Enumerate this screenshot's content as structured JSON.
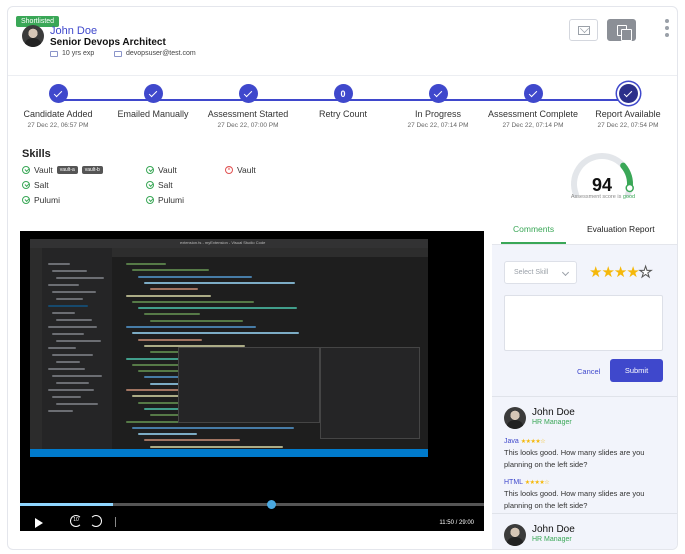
{
  "candidate": {
    "badge": "Shortlisted",
    "name": "John Doe",
    "title": "Senior Devops Architect",
    "experience": "10 yrs exp",
    "email": "devopsuser@test.com"
  },
  "timeline": {
    "steps": [
      {
        "label": "Candidate Added",
        "time": "27 Dec 22,  06:57 PM",
        "state": "done"
      },
      {
        "label": "Emailed Manually",
        "time": "",
        "state": "done"
      },
      {
        "label": "Assessment Started",
        "time": "27 Dec 22,  07:00 PM",
        "state": "done"
      },
      {
        "label": "Retry Count",
        "time": "",
        "state": "count",
        "count": "0"
      },
      {
        "label": "In Progress",
        "time": "27 Dec 22,  07:14 PM",
        "state": "done"
      },
      {
        "label": "Assessment Complete",
        "time": "27 Dec 22,  07:14 PM",
        "state": "done"
      },
      {
        "label": "Report Available",
        "time": "27 Dec 22,  07:54 PM",
        "state": "current"
      }
    ]
  },
  "skills": {
    "heading": "Skills",
    "col1": [
      "Vault",
      "Salt",
      "Pulumi"
    ],
    "col1_tags": [
      "vault-a",
      "vault-b"
    ],
    "col2": [
      "Vault",
      "Salt",
      "Pulumi"
    ],
    "col3": [
      "Vault"
    ]
  },
  "assessment": {
    "score": "94",
    "caption_prefix": "Assessment score is ",
    "caption_status": "good",
    "score_fraction": 0.94
  },
  "video": {
    "window_title": "extension.ts - myExtension - Visual Studio Code",
    "time": "11:50 / 29:00",
    "progress_fraction": 0.54
  },
  "panel": {
    "tab_comments": "Comments",
    "tab_evaluation": "Evaluation Report",
    "select_placeholder": "Select Skill",
    "rating": 4,
    "rating_max": 5,
    "cancel_label": "Cancel",
    "submit_label": "Submit",
    "comments": [
      {
        "name": "John Doe",
        "role": "HR Manager",
        "entries": [
          {
            "skill": "Java",
            "stars": "★★★★☆",
            "text": "This looks good. How many slides are you planning on the left side?"
          },
          {
            "skill": "HTML",
            "stars": "★★★★☆",
            "text": "This looks good. How many slides are you planning on the left side?"
          }
        ]
      },
      {
        "name": "John Doe",
        "role": "HR Manager",
        "entries": []
      }
    ]
  },
  "colors": {
    "accent": "#3f48cc",
    "good": "#3aa757",
    "star": "#f5b80a"
  }
}
